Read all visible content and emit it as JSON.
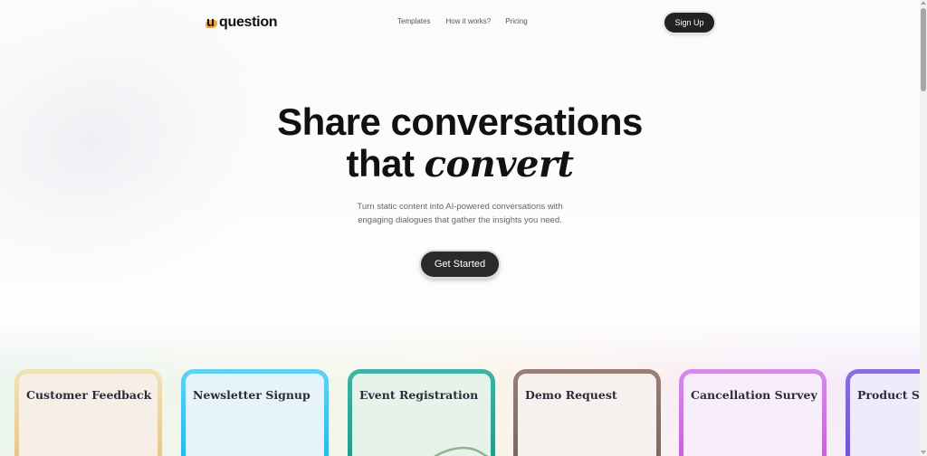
{
  "brand": {
    "name": "question",
    "logo_mark": "u"
  },
  "nav": {
    "links": [
      "Templates",
      "How it works?",
      "Pricing"
    ],
    "signup_label": "Sign Up"
  },
  "hero": {
    "title_line1": "Share conversations",
    "title_line2_plain": "that ",
    "title_line2_accent": "convert",
    "subtitle_line1": "Turn static content into AI-powered conversations with",
    "subtitle_line2": "engaging dialogues that gather the insights you need.",
    "cta_label": "Get Started"
  },
  "templates": [
    {
      "title": "Customer Feedback",
      "accent": "#e3c48a"
    },
    {
      "title": "Newsletter Signup",
      "accent": "#22b5ea"
    },
    {
      "title": "Event Registration",
      "accent": "#1f9a86"
    },
    {
      "title": "Demo Request",
      "accent": "#7d635a"
    },
    {
      "title": "Cancellation Survey",
      "accent": "#c25fd9"
    },
    {
      "title": "Product Su",
      "accent": "#6e4fd3"
    }
  ],
  "colors": {
    "primary_button": "#222222",
    "text": "#111111",
    "logo_accent": "#f3a83a"
  }
}
